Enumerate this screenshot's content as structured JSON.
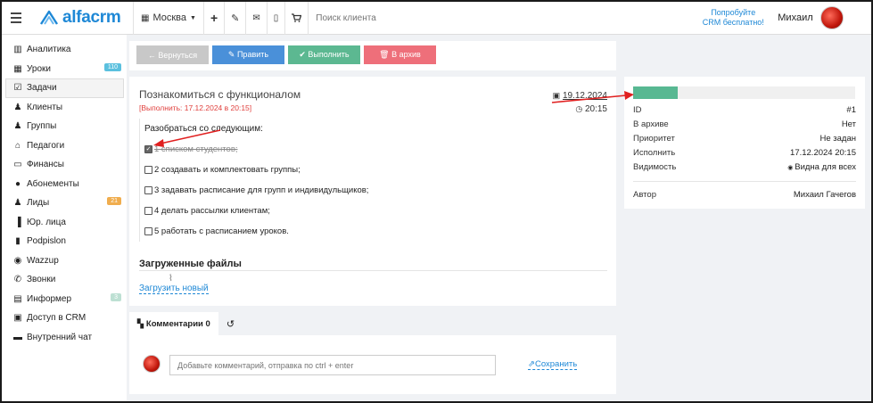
{
  "header": {
    "city": "Москва",
    "search_placeholder": "Поиск клиента",
    "try_line1": "Попробуйте",
    "try_line2": "CRM бесплатно!",
    "user_name": "Михаил",
    "logo_text": "alfacrm"
  },
  "sidebar": {
    "items": [
      {
        "label": "Аналитика",
        "icon": "analytics-icon",
        "glyph": "▥"
      },
      {
        "label": "Уроки",
        "icon": "calendar-icon",
        "glyph": "▦",
        "badge": "110",
        "badge_color": "#5bc0de"
      },
      {
        "label": "Задачи",
        "icon": "tasks-icon",
        "glyph": "☑"
      },
      {
        "label": "Клиенты",
        "icon": "user-icon",
        "glyph": "♟"
      },
      {
        "label": "Группы",
        "icon": "group-icon",
        "glyph": "♟"
      },
      {
        "label": "Педагоги",
        "icon": "graduation-cap-icon",
        "glyph": "⌂"
      },
      {
        "label": "Финансы",
        "icon": "money-icon",
        "glyph": "▭"
      },
      {
        "label": "Абонементы",
        "icon": "subscription-icon",
        "glyph": "●"
      },
      {
        "label": "Лиды",
        "icon": "leads-icon",
        "glyph": "♟",
        "badge": "21",
        "badge_color": "#f0ad4e"
      },
      {
        "label": "Юр. лица",
        "icon": "legal-entity-icon",
        "glyph": "▐"
      },
      {
        "label": "Podpislon",
        "icon": "document-icon",
        "glyph": "▮"
      },
      {
        "label": "Wazzup",
        "icon": "whatsapp-icon",
        "glyph": "◉"
      },
      {
        "label": "Звонки",
        "icon": "phone-icon",
        "glyph": "✆"
      },
      {
        "label": "Информер",
        "icon": "informer-icon",
        "glyph": "▤",
        "badge": "3",
        "badge_color": "#bde0d3"
      },
      {
        "label": "Доступ в CRM",
        "icon": "lock-icon",
        "glyph": "▣"
      },
      {
        "label": "Внутренний чат",
        "icon": "chat-icon",
        "glyph": "▬"
      }
    ]
  },
  "toolbar": {
    "back": "← Вернуться",
    "edit": "✎ Править",
    "complete": "✔ Выполнить",
    "archive": "🗑 В архив",
    "colors": {
      "back": "#c8c8c8",
      "edit": "#4a90d9",
      "complete": "#5cb891",
      "archive": "#ee6f7a"
    }
  },
  "task": {
    "title": "Познакомиться с функционалом",
    "due": "[Выполнить: 17.12.2024 в 20:15]",
    "date": "19.12.2024",
    "time": "20:15",
    "intro": "Разобраться со следующим:",
    "checklist": [
      {
        "label": "1 списком студентов;",
        "checked": true
      },
      {
        "label": "2 создавать и комплектовать группы;",
        "checked": false
      },
      {
        "label": "3 задавать расписание для групп и индивидульщиков;",
        "checked": false
      },
      {
        "label": "4 делать рассылки клиентам;",
        "checked": false
      },
      {
        "label": "5 работать с расписанием уроков.",
        "checked": false
      }
    ],
    "files_title": "Загруженные файлы",
    "upload_label": "Загрузить новый"
  },
  "comments": {
    "tab_comments": "Комментарии 0",
    "placeholder": "Добавьте комментарий, отправка по ctrl + enter",
    "save": "Сохранить"
  },
  "props": {
    "progress": 0.2,
    "progress_color": "#58b892",
    "rows": [
      {
        "label": "ID",
        "value": "#1"
      },
      {
        "label": "В архиве",
        "value": "Нет"
      },
      {
        "label": "Приоритет",
        "value": "Не задан"
      },
      {
        "label": "Исполнить",
        "value": "17.12.2024 20:15"
      },
      {
        "label": "Видимость",
        "value": "Видна для всех"
      }
    ],
    "author_label": "Автор",
    "author_value": "Михаил Гачегов"
  }
}
